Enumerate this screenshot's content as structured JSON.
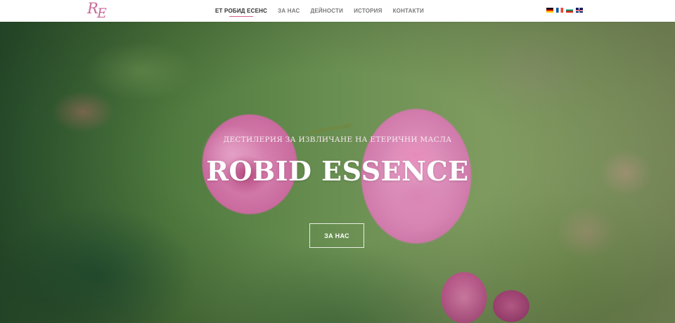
{
  "header": {
    "logo_letters": [
      "R",
      "E"
    ],
    "nav": [
      {
        "label": "ЕТ РОБИД ЕСЕНС",
        "active": true
      },
      {
        "label": "ЗА НАС",
        "active": false
      },
      {
        "label": "ДЕЙНОСТИ",
        "active": false
      },
      {
        "label": "ИСТОРИЯ",
        "active": false
      },
      {
        "label": "КОНТАКТИ",
        "active": false
      }
    ],
    "flags": [
      "flag-de-icon",
      "flag-fr-icon",
      "flag-bg-icon",
      "flag-gb-icon"
    ]
  },
  "hero": {
    "subtitle": "ДЕСТИЛЕРИЯ ЗА ИЗВЛИЧАНЕ НА ЕТЕРИЧНИ МАСЛА",
    "title": "ROBID ESSENCE",
    "button_label": "ЗА НАС"
  },
  "colors": {
    "accent": "#d6608e",
    "logo": "#c86a98"
  }
}
